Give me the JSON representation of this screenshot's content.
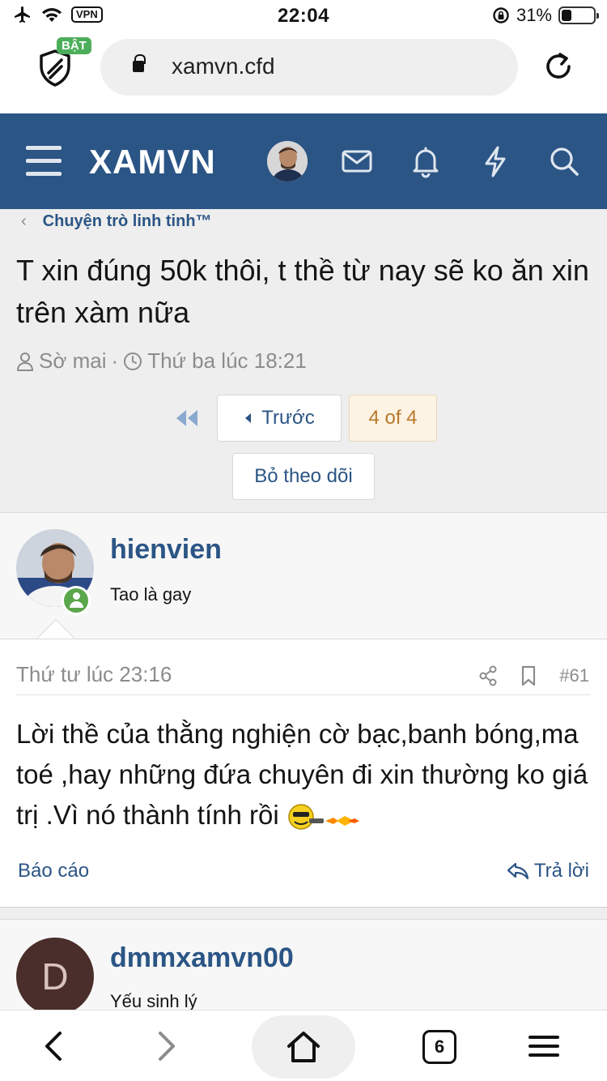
{
  "status_bar": {
    "time": "22:04",
    "vpn": "VPN",
    "battery": "31%",
    "battery_level": 0.31
  },
  "browser": {
    "url": "xamvn.cfd",
    "shield_badge": "BẬT"
  },
  "site": {
    "logo": "XAMVN"
  },
  "breadcrumb": {
    "label": "Chuyện trò linh tinh™",
    "back_glyph": "‹"
  },
  "thread": {
    "title": "T xin đúng 50k thôi, t thề từ nay sẽ ko ăn xin trên xàm nữa",
    "author": "Sờ mai",
    "separator": "·",
    "date": "Thứ ba lúc 18:21"
  },
  "pagination": {
    "prev_label": "Trước",
    "current": "4 of 4",
    "unwatch": "Bỏ theo dõi"
  },
  "posts": [
    {
      "username": "hienvien",
      "user_title": "Tao là gay",
      "date": "Thứ tư lúc 23:16",
      "number": "#61",
      "content": "Lời thề của thằng nghiện cờ bạc,banh bóng,ma toé ,hay những đứa chuyên đi xin thường ko giá trị .Vì nó thành tính rồi",
      "report_label": "Báo cáo",
      "reply_label": "Trả lời"
    },
    {
      "username": "dmmxamvn00",
      "user_title": "Yếu sinh lý",
      "avatar_letter": "D"
    }
  ],
  "toolbar": {
    "tabs_count": "6"
  },
  "colors": {
    "header_bg": "#2b5585",
    "link": "#2b5585",
    "online": "#5aa64a",
    "current_page_bg": "#fdf3e4"
  }
}
